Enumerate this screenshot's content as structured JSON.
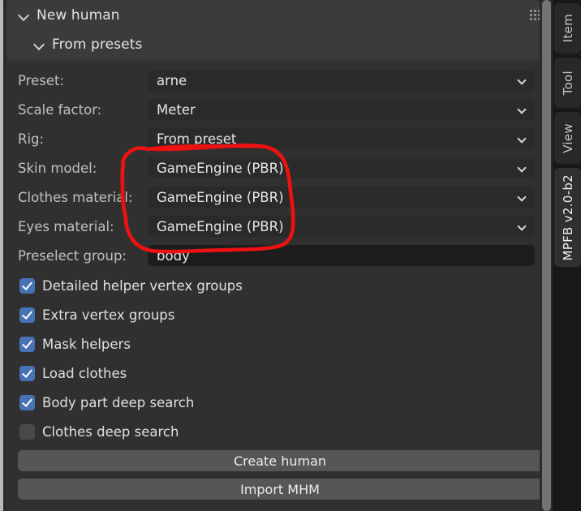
{
  "panel": {
    "title": "New human",
    "subsection": "From presets",
    "grip_icon": "grip-dots-icon"
  },
  "properties": [
    {
      "label": "Preset:",
      "value": "arne",
      "type": "dropdown"
    },
    {
      "label": "Scale factor:",
      "value": "Meter",
      "type": "dropdown"
    },
    {
      "label": "Rig:",
      "value": "From preset",
      "type": "dropdown"
    },
    {
      "label": "Skin model:",
      "value": "GameEngine (PBR)",
      "type": "dropdown"
    },
    {
      "label": "Clothes material:",
      "value": "GameEngine (PBR)",
      "type": "dropdown"
    },
    {
      "label": "Eyes material:",
      "value": "GameEngine (PBR)",
      "type": "dropdown"
    },
    {
      "label": "Preselect group:",
      "value": "body",
      "type": "text"
    }
  ],
  "checkboxes": [
    {
      "label": "Detailed helper vertex groups",
      "checked": true
    },
    {
      "label": "Extra vertex groups",
      "checked": true
    },
    {
      "label": "Mask helpers",
      "checked": true
    },
    {
      "label": "Load clothes",
      "checked": true
    },
    {
      "label": "Body part deep search",
      "checked": true
    },
    {
      "label": "Clothes deep search",
      "checked": false
    }
  ],
  "actions": [
    {
      "label": "Create human"
    },
    {
      "label": "Import MHM"
    }
  ],
  "tabs": [
    {
      "label": "Item",
      "active": false
    },
    {
      "label": "Tool",
      "active": false
    },
    {
      "label": "View",
      "active": false
    },
    {
      "label": "MPFB v2.0-b2",
      "active": true
    }
  ],
  "colors": {
    "panel_bg": "#303030",
    "header_bg": "#3b3b3b",
    "field_bg": "#2a2a2a",
    "text_input_bg": "#1d1d1d",
    "checkbox_on": "#4772b3",
    "checkbox_off": "#4a4a4a",
    "button_bg": "#565656",
    "annotation": "#ee1111",
    "scrollbar": "#737373"
  },
  "annotation": {
    "type": "hand-drawn-ellipse",
    "target": "skin-clothes-eyes-material-dropdowns",
    "color": "#ee1111"
  }
}
